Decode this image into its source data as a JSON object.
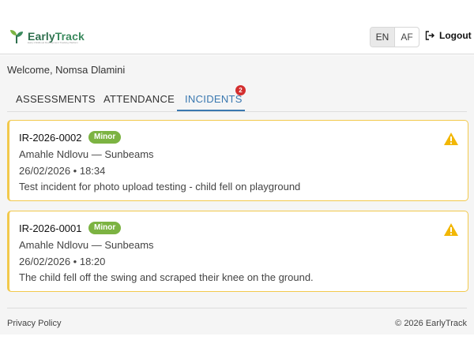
{
  "header": {
    "logo": {
      "text_early": "Early",
      "text_track": "Track",
      "tagline": "Early Childhood Development Tracking Platform",
      "icon": "sprout-icon"
    },
    "languages": [
      {
        "label": "EN",
        "active": true
      },
      {
        "label": "AF",
        "active": false
      }
    ],
    "logout_label": "Logout"
  },
  "main": {
    "welcome": "Welcome, Nomsa Dlamini",
    "tabs": [
      {
        "label": "ASSESSMENTS",
        "active": false
      },
      {
        "label": "ATTENDANCE",
        "active": false
      },
      {
        "label": "INCIDENTS",
        "active": true,
        "badge": "2"
      }
    ],
    "incidents": [
      {
        "id": "IR-2026-0002",
        "severity": "Minor",
        "child": "Amahle Ndlovu — Sunbeams",
        "datetime": "26/02/2026 • 18:34",
        "description": "Test incident for photo upload testing - child fell on playground"
      },
      {
        "id": "IR-2026-0001",
        "severity": "Minor",
        "child": "Amahle Ndlovu — Sunbeams",
        "datetime": "26/02/2026 • 18:20",
        "description": "The child fell off the swing and scraped their knee on the ground."
      }
    ]
  },
  "footer": {
    "privacy": "Privacy Policy",
    "copyright": "© 2026 EarlyTrack"
  },
  "colors": {
    "accent": "#3a78b0",
    "warning": "#f2c94c",
    "minor": "#7cb342",
    "badge": "#d32f2f"
  }
}
